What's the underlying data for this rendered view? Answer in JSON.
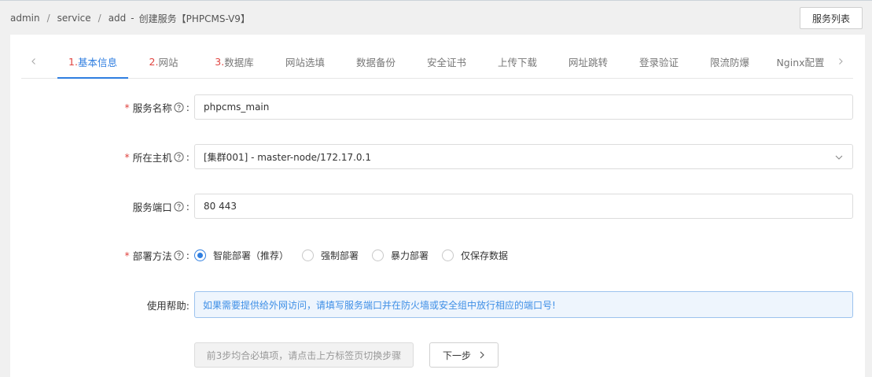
{
  "breadcrumb": {
    "items": [
      "admin",
      "service",
      "add"
    ],
    "page_title": "创建服务【PHPCMS-V9】"
  },
  "header": {
    "list_button": "服务列表"
  },
  "tabs": [
    {
      "num": "1.",
      "label": "基本信息",
      "active": true
    },
    {
      "num": "2.",
      "label": "网站"
    },
    {
      "num": "3.",
      "label": "数据库"
    },
    {
      "num": "",
      "label": "网站选填"
    },
    {
      "num": "",
      "label": "数据备份"
    },
    {
      "num": "",
      "label": "安全证书"
    },
    {
      "num": "",
      "label": "上传下载"
    },
    {
      "num": "",
      "label": "网址跳转"
    },
    {
      "num": "",
      "label": "登录验证"
    },
    {
      "num": "",
      "label": "限流防爆"
    },
    {
      "num": "",
      "label": "Nginx配置"
    }
  ],
  "form": {
    "service_name": {
      "label": "服务名称",
      "required": true,
      "value": "phpcms_main"
    },
    "host": {
      "label": "所在主机",
      "required": true,
      "value": "[集群001] - master-node/172.17.0.1"
    },
    "port": {
      "label": "服务端口",
      "required": false,
      "value": "80 443"
    },
    "deploy": {
      "label": "部署方法",
      "required": true,
      "options": [
        "智能部署（推荐）",
        "强制部署",
        "暴力部署",
        "仅保存数据"
      ],
      "selected": 0
    },
    "help": {
      "label": "使用帮助:",
      "text": "如果需要提供给外网访问，请填写服务端口并在防火墙或安全组中放行相应的端口号!"
    }
  },
  "footer": {
    "hint": "前3步均合必填项，请点击上方标签页切换步骤",
    "next": "下一步"
  },
  "colors": {
    "accent": "#2f7ee0",
    "required": "#e0433f",
    "help_bg": "#eef5fd",
    "help_border": "#9cc3ee"
  }
}
